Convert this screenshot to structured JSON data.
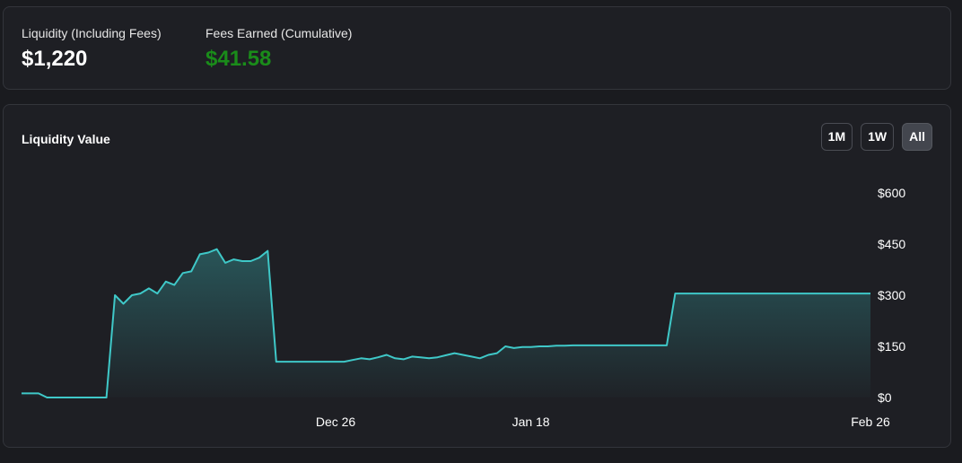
{
  "stats": {
    "liquidity_label": "Liquidity (Including Fees)",
    "liquidity_value": "$1,220",
    "fees_label": "Fees Earned (Cumulative)",
    "fees_value": "$41.58",
    "fees_color": "#1a8c1a"
  },
  "chart": {
    "title": "Liquidity Value",
    "ranges": [
      {
        "label": "1M",
        "active": false
      },
      {
        "label": "1W",
        "active": false
      },
      {
        "label": "All",
        "active": true
      }
    ],
    "line_color": "#3fc8c8"
  },
  "chart_data": {
    "type": "area",
    "title": "Liquidity Value",
    "xlabel": "",
    "ylabel": "",
    "x_ticks": [
      "Dec 26",
      "Jan 18",
      "Feb 26"
    ],
    "y_ticks": [
      "$0",
      "$150",
      "$300",
      "$450",
      "$600"
    ],
    "ylim": [
      0,
      600
    ],
    "grid": false,
    "x": [
      "Nov 19",
      "Nov 20",
      "Nov 21",
      "Nov 22",
      "Nov 23",
      "Nov 24",
      "Nov 25",
      "Nov 26",
      "Nov 27",
      "Nov 28",
      "Nov 29",
      "Nov 30",
      "Dec 1",
      "Dec 2",
      "Dec 3",
      "Dec 4",
      "Dec 5",
      "Dec 6",
      "Dec 7",
      "Dec 8",
      "Dec 9",
      "Dec 10",
      "Dec 11",
      "Dec 12",
      "Dec 13",
      "Dec 14",
      "Dec 15",
      "Dec 16",
      "Dec 17",
      "Dec 18",
      "Dec 19",
      "Dec 20",
      "Dec 21",
      "Dec 22",
      "Dec 23",
      "Dec 24",
      "Dec 25",
      "Dec 26",
      "Dec 27",
      "Dec 28",
      "Dec 29",
      "Dec 30",
      "Dec 31",
      "Jan 1",
      "Jan 2",
      "Jan 3",
      "Jan 4",
      "Jan 5",
      "Jan 6",
      "Jan 7",
      "Jan 8",
      "Jan 9",
      "Jan 10",
      "Jan 11",
      "Jan 12",
      "Jan 13",
      "Jan 14",
      "Jan 15",
      "Jan 16",
      "Jan 17",
      "Jan 18",
      "Jan 19",
      "Jan 20",
      "Jan 21",
      "Jan 22",
      "Jan 23",
      "Jan 24",
      "Jan 25",
      "Jan 26",
      "Jan 27",
      "Jan 28",
      "Jan 29",
      "Jan 30",
      "Jan 31",
      "Feb 1",
      "Feb 2",
      "Feb 3",
      "Feb 4",
      "Feb 5",
      "Feb 6",
      "Feb 7",
      "Feb 8",
      "Feb 9",
      "Feb 10",
      "Feb 11",
      "Feb 12",
      "Feb 13",
      "Feb 14",
      "Feb 15",
      "Feb 16",
      "Feb 17",
      "Feb 18",
      "Feb 19",
      "Feb 20",
      "Feb 21",
      "Feb 22",
      "Feb 23",
      "Feb 24",
      "Feb 25",
      "Feb 26"
    ],
    "values": [
      12,
      12,
      12,
      0,
      0,
      0,
      0,
      0,
      0,
      0,
      0,
      300,
      275,
      300,
      305,
      320,
      305,
      340,
      330,
      365,
      370,
      420,
      425,
      435,
      395,
      405,
      400,
      400,
      410,
      430,
      105,
      105,
      105,
      105,
      105,
      105,
      105,
      105,
      105,
      110,
      115,
      112,
      118,
      125,
      115,
      112,
      120,
      118,
      115,
      118,
      124,
      130,
      125,
      120,
      115,
      125,
      130,
      150,
      145,
      148,
      148,
      150,
      150,
      152,
      152,
      153,
      153,
      153,
      153,
      153,
      153,
      153,
      153,
      153,
      153,
      153,
      153,
      305,
      305,
      305,
      305,
      305,
      305,
      305,
      305,
      305,
      305,
      305,
      305,
      305,
      305,
      305,
      305,
      305,
      305,
      305,
      305,
      305,
      305,
      305,
      305
    ],
    "series": [
      {
        "values": []
      }
    ]
  }
}
